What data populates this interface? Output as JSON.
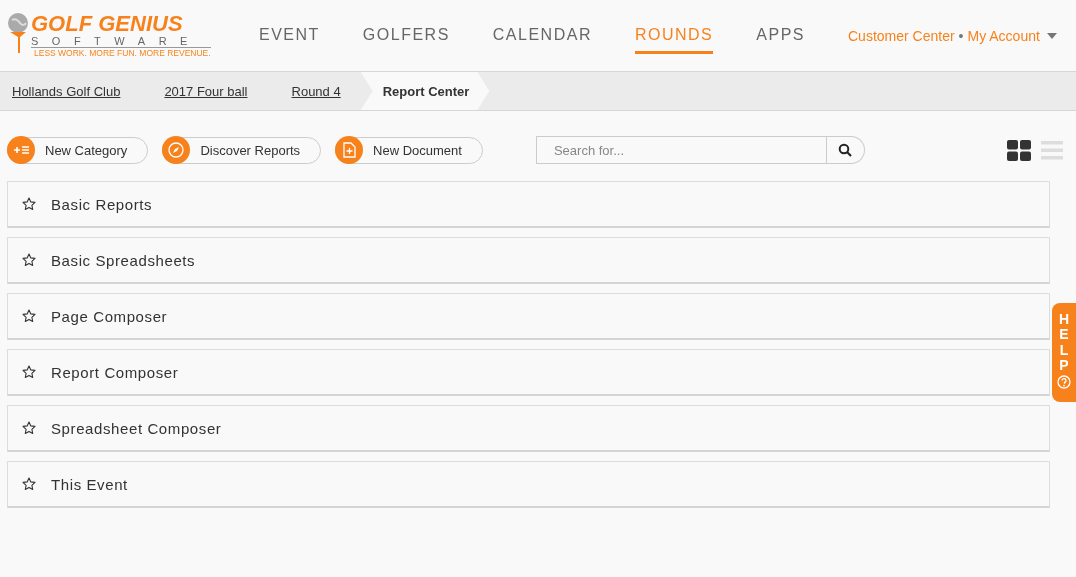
{
  "logo": {
    "name": "GOLF GENIUS",
    "subtitle": "SOFTWARE",
    "tagline": "LESS WORK. MORE FUN. MORE REVENUE."
  },
  "nav": [
    {
      "label": "EVENT",
      "selected": false
    },
    {
      "label": "GOLFERS",
      "selected": false
    },
    {
      "label": "CALENDAR",
      "selected": false
    },
    {
      "label": "ROUNDS",
      "selected": true
    },
    {
      "label": "APPS",
      "selected": false
    }
  ],
  "account_separator": "•",
  "account_links": [
    {
      "label": "Customer Center",
      "has_menu": false
    },
    {
      "label": "My Account",
      "has_menu": true
    }
  ],
  "breadcrumbs": [
    {
      "label": "Hollands Golf Club",
      "selected": false
    },
    {
      "label": "2017 Four ball",
      "selected": false
    },
    {
      "label": "Round 4",
      "selected": false
    },
    {
      "label": "Report Center",
      "selected": true
    }
  ],
  "actions": [
    {
      "label": "New Category",
      "kind": "category"
    },
    {
      "label": "Discover Reports",
      "kind": "discover"
    },
    {
      "label": "New Document",
      "kind": "document"
    }
  ],
  "search": {
    "placeholder": "Search for..."
  },
  "views": [
    {
      "kind": "grid",
      "selected": true
    },
    {
      "kind": "list",
      "selected": false
    }
  ],
  "categories": [
    {
      "name": "Basic Reports",
      "starred": false
    },
    {
      "name": "Basic Spreadsheets",
      "starred": false
    },
    {
      "name": "Page Composer",
      "starred": false
    },
    {
      "name": "Report Composer",
      "starred": false
    },
    {
      "name": "Spreadsheet Composer",
      "starred": false
    },
    {
      "name": "This Event",
      "starred": false
    }
  ],
  "help_tab": {
    "label": "HELP"
  }
}
